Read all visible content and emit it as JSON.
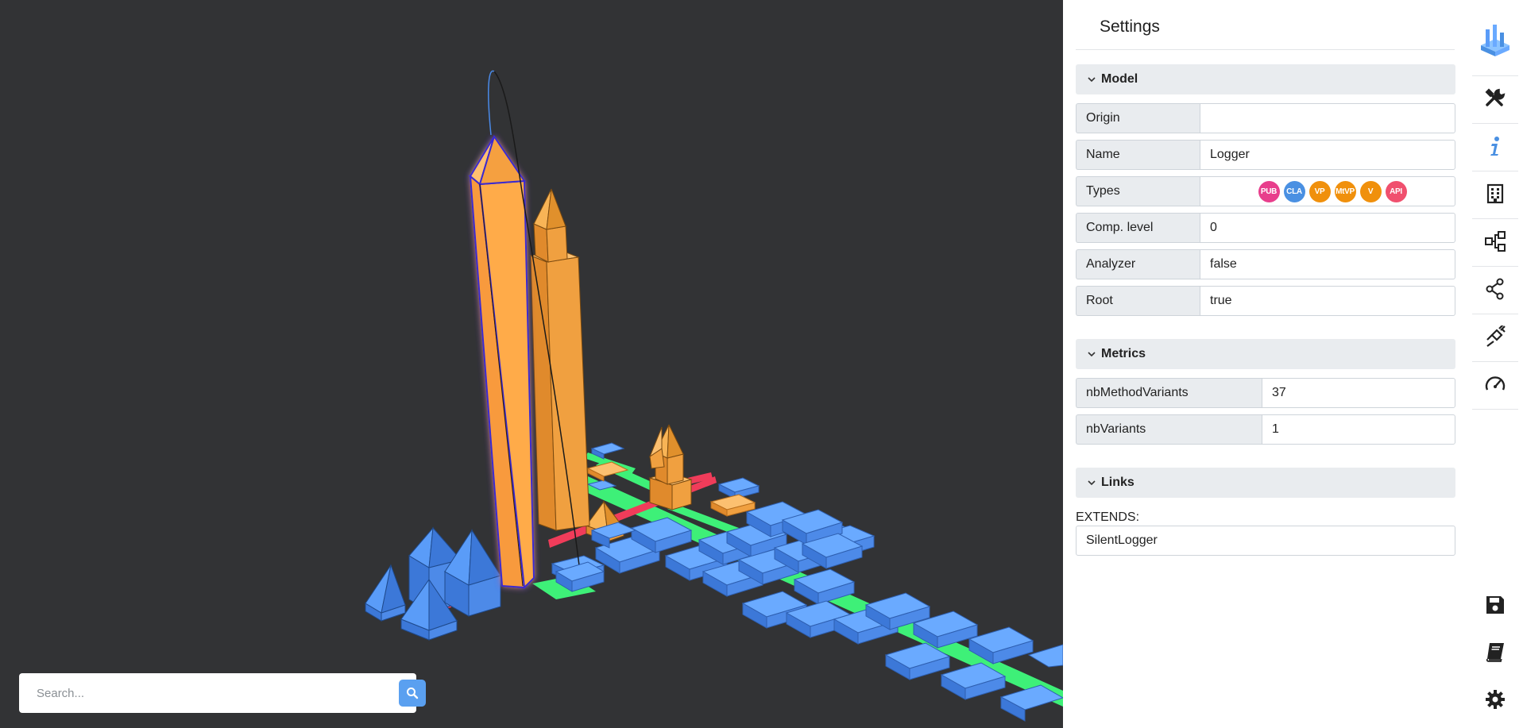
{
  "search": {
    "placeholder": "Search..."
  },
  "settings": {
    "title": "Settings",
    "model": {
      "header": "Model",
      "origin_label": "Origin",
      "origin_value": "",
      "name_label": "Name",
      "name_value": "Logger",
      "types_label": "Types",
      "types": [
        {
          "text": "PUB",
          "color": "#e83e8c"
        },
        {
          "text": "CLA",
          "color": "#4a90e2"
        },
        {
          "text": "VP",
          "color": "#f0900c"
        },
        {
          "text": "MtVP",
          "color": "#f0900c"
        },
        {
          "text": "V",
          "color": "#f0900c"
        },
        {
          "text": "API",
          "color": "#f0506e"
        }
      ],
      "comp_level_label": "Comp. level",
      "comp_level_value": "0",
      "analyzer_label": "Analyzer",
      "analyzer_value": "false",
      "root_label": "Root",
      "root_value": "true"
    },
    "metrics": {
      "header": "Metrics",
      "nb_method_variants_label": "nbMethodVariants",
      "nb_method_variants_value": "37",
      "nb_variants_label": "nbVariants",
      "nb_variants_value": "1"
    },
    "links": {
      "header": "Links",
      "extends_label": "EXTENDS:",
      "extends_value": "SilentLogger"
    }
  },
  "toolbar": {
    "top": [
      "logo-icon",
      "tools-icon",
      "info-icon",
      "building-icon",
      "hierarchy-icon",
      "share-icon",
      "plug-icon",
      "speedometer-icon"
    ],
    "bottom": [
      "save-icon",
      "book-icon",
      "gear-icon"
    ]
  },
  "colors": {
    "scene_bg": "#323335",
    "class_orange": "#f8a94c",
    "class_blue": "#5a9cf8",
    "link_green": "#3ef078",
    "link_red": "#f03c5a",
    "accent": "#5aa0f0"
  }
}
